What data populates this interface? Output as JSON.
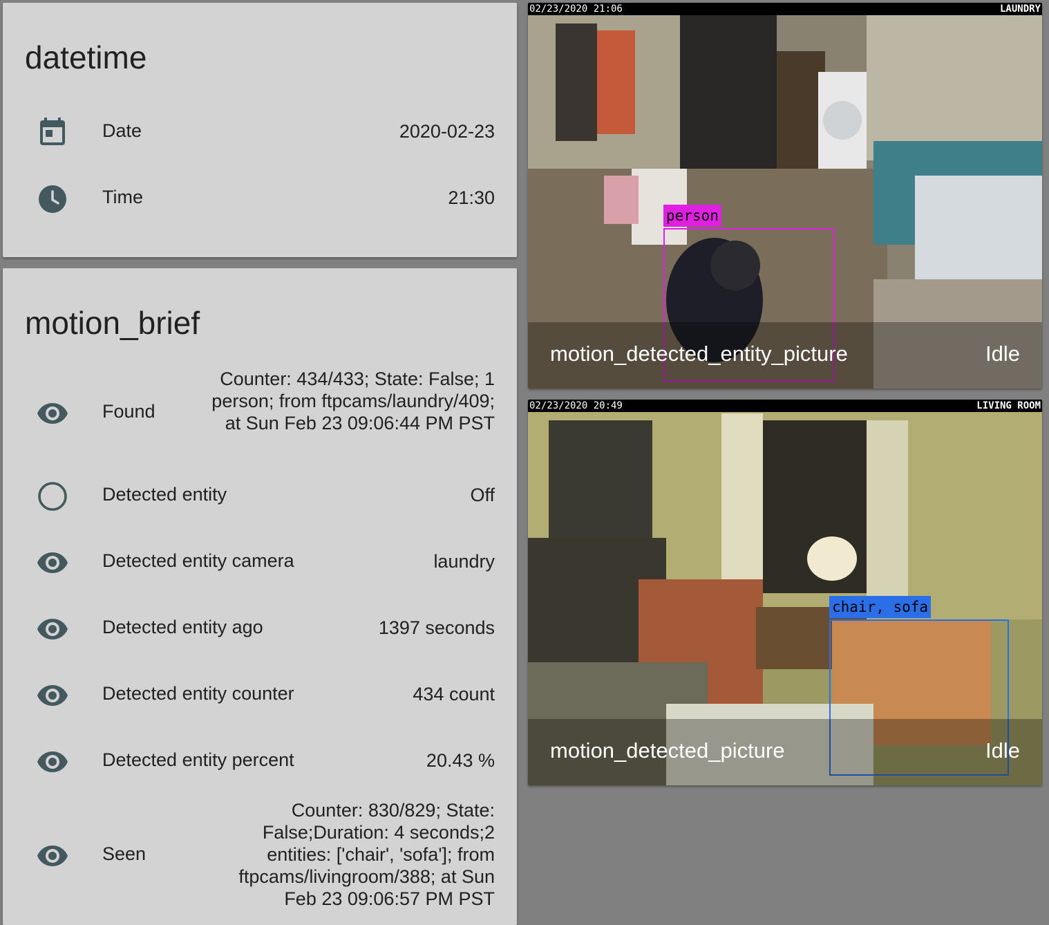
{
  "datetime_card": {
    "title": "datetime",
    "rows": [
      {
        "label": "Date",
        "value": "2020-02-23",
        "icon": "calendar-icon"
      },
      {
        "label": "Time",
        "value": "21:30",
        "icon": "clock-icon"
      }
    ]
  },
  "motion_card": {
    "title": "motion_brief",
    "rows": [
      {
        "label": "Found",
        "value": "Counter: 434/433; State: False; 1 person; from ftpcams/laundry/409; at Sun Feb 23 09:06:44 PM PST",
        "icon": "eye-icon"
      },
      {
        "label": "Detected entity",
        "value": "Off",
        "icon": "circle-outline-icon"
      },
      {
        "label": "Detected entity camera",
        "value": "laundry",
        "icon": "eye-icon"
      },
      {
        "label": "Detected entity ago",
        "value": "1397 seconds",
        "icon": "eye-icon"
      },
      {
        "label": "Detected entity counter",
        "value": "434 count",
        "icon": "eye-icon"
      },
      {
        "label": "Detected entity percent",
        "value": "20.43 %",
        "icon": "eye-icon"
      },
      {
        "label": "Seen",
        "value": "Counter: 830/829; State: False;Duration: 4 seconds;2 entities: ['chair', 'sofa']; from ftpcams/livingroom/388; at Sun Feb 23 09:06:57 PM PST",
        "icon": "eye-icon"
      }
    ]
  },
  "cameras": [
    {
      "timestamp": "02/23/2020 21:06",
      "room": "LAUNDRY",
      "name": "motion_detected_entity_picture",
      "state": "Idle",
      "detection_label": "person",
      "detection_color": "#e020e0"
    },
    {
      "timestamp": "02/23/2020 20:49",
      "room": "LIVING ROOM",
      "name": "motion_detected_picture",
      "state": "Idle",
      "detection_label": "chair, sofa",
      "detection_color": "#2a6fe8"
    }
  ],
  "colors": {
    "card_background": "#d3d3d3",
    "page_background": "#808080",
    "icon_color": "#44595e"
  }
}
